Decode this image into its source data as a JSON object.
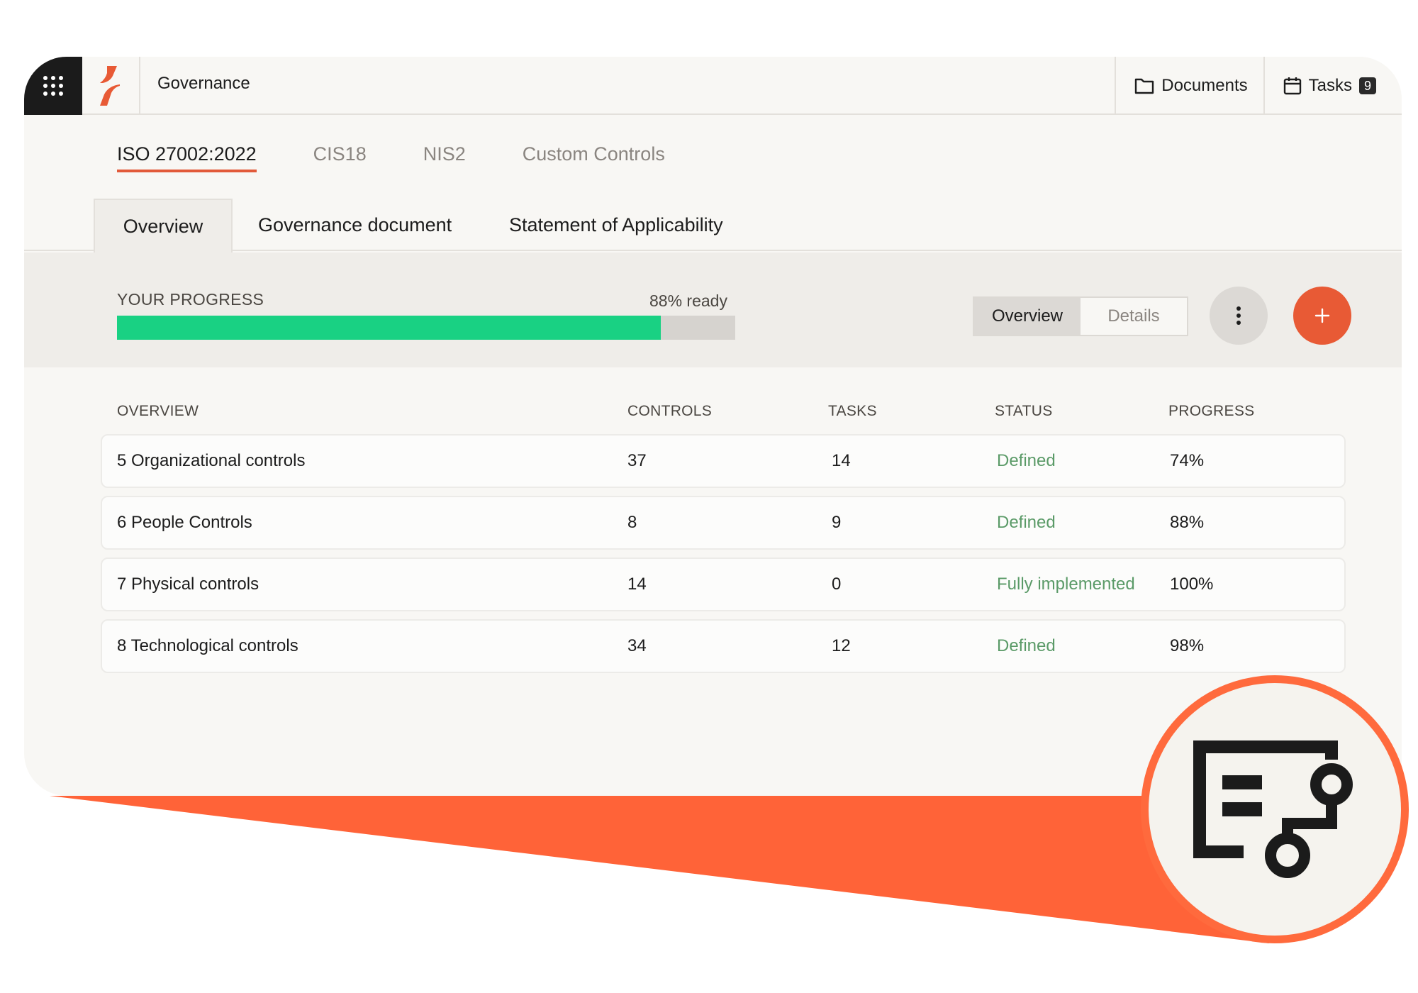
{
  "topbar": {
    "app_title": "Governance",
    "documents_label": "Documents",
    "tasks_label": "Tasks",
    "tasks_count": "9",
    "icons": {
      "apps": "grid-icon",
      "logo": "brand-logo",
      "documents": "folder-icon",
      "tasks": "calendar-icon"
    }
  },
  "framework_tabs": [
    {
      "label": "ISO 27002:2022",
      "active": true
    },
    {
      "label": "CIS18",
      "active": false
    },
    {
      "label": "NIS2",
      "active": false
    },
    {
      "label": "Custom Controls",
      "active": false
    }
  ],
  "view_tabs": [
    {
      "label": "Overview",
      "active": true
    },
    {
      "label": "Governance document",
      "active": false
    },
    {
      "label": "Statement of Applicability",
      "active": false
    }
  ],
  "progress": {
    "label": "YOUR PROGRESS",
    "ready_text": "88% ready",
    "value_percent": 88,
    "bar_color": "#19d183"
  },
  "view_toggle": {
    "options": [
      "Overview",
      "Details"
    ],
    "selected": "Overview"
  },
  "actions": {
    "more_icon": "more-vertical-icon",
    "add_icon": "plus-icon",
    "add_color": "#e85a35"
  },
  "table": {
    "headers": [
      "OVERVIEW",
      "CONTROLS",
      "TASKS",
      "STATUS",
      "PROGRESS"
    ],
    "rows": [
      {
        "overview": "5 Organizational controls",
        "controls": "37",
        "tasks": "14",
        "status": "Defined",
        "progress": "74%"
      },
      {
        "overview": "6 People Controls",
        "controls": "8",
        "tasks": "9",
        "status": "Defined",
        "progress": "88%"
      },
      {
        "overview": "7 Physical controls",
        "controls": "14",
        "tasks": "0",
        "status": "Fully implemented",
        "progress": "100%"
      },
      {
        "overview": "8 Technological controls",
        "controls": "34",
        "tasks": "12",
        "status": "Defined",
        "progress": "98%"
      }
    ]
  },
  "colors": {
    "accent": "#ff6a3d",
    "status_green": "#5a9a67",
    "dark": "#1b1b1b"
  },
  "feature_icon": "governance-workflow-icon"
}
